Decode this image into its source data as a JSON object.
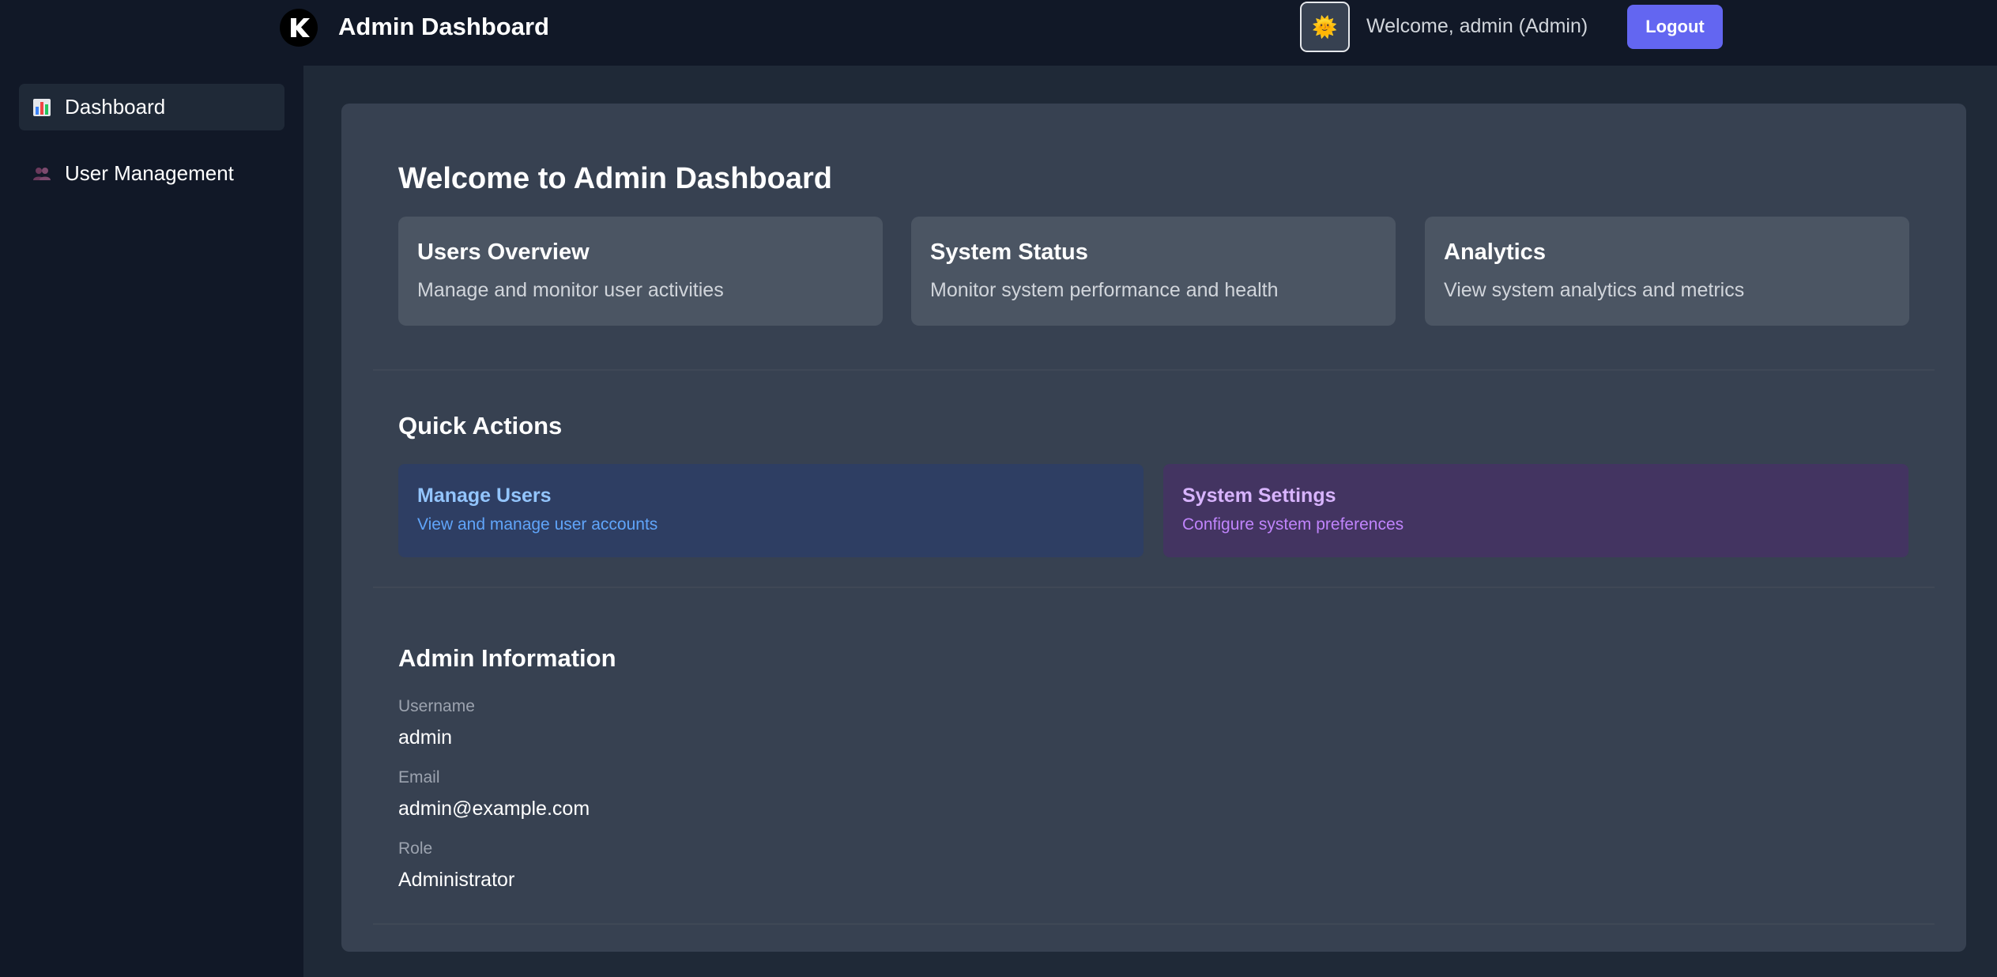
{
  "header": {
    "app_title": "Admin Dashboard",
    "logo_icon": "k-logo-icon",
    "avatar_icon": "sun-face-emoji",
    "avatar_glyph": "🌞",
    "welcome_text": "Welcome, admin (Admin)",
    "logout_label": "Logout"
  },
  "sidebar": {
    "items": [
      {
        "label": "Dashboard",
        "icon": "bar-chart-icon",
        "active": true
      },
      {
        "label": "User Management",
        "icon": "users-icon",
        "active": false
      }
    ]
  },
  "main": {
    "heading": "Welcome to Admin Dashboard",
    "cards": [
      {
        "title": "Users Overview",
        "description": "Manage and monitor user activities"
      },
      {
        "title": "System Status",
        "description": "Monitor system performance and health"
      },
      {
        "title": "Analytics",
        "description": "View system analytics and metrics"
      }
    ],
    "quick_actions": {
      "heading": "Quick Actions",
      "items": [
        {
          "title": "Manage Users",
          "description": "View and manage user accounts",
          "color": "#93c5fd"
        },
        {
          "title": "System Settings",
          "description": "Configure system preferences",
          "color": "#d8b4fe"
        }
      ]
    },
    "admin_info": {
      "heading": "Admin Information",
      "fields": [
        {
          "label": "Username",
          "value": "admin"
        },
        {
          "label": "Email",
          "value": "admin@example.com"
        },
        {
          "label": "Role",
          "value": "Administrator"
        }
      ]
    }
  },
  "colors": {
    "accent": "#6366f1",
    "background": "#111827",
    "panel": "#374151",
    "card": "#4b5563"
  }
}
